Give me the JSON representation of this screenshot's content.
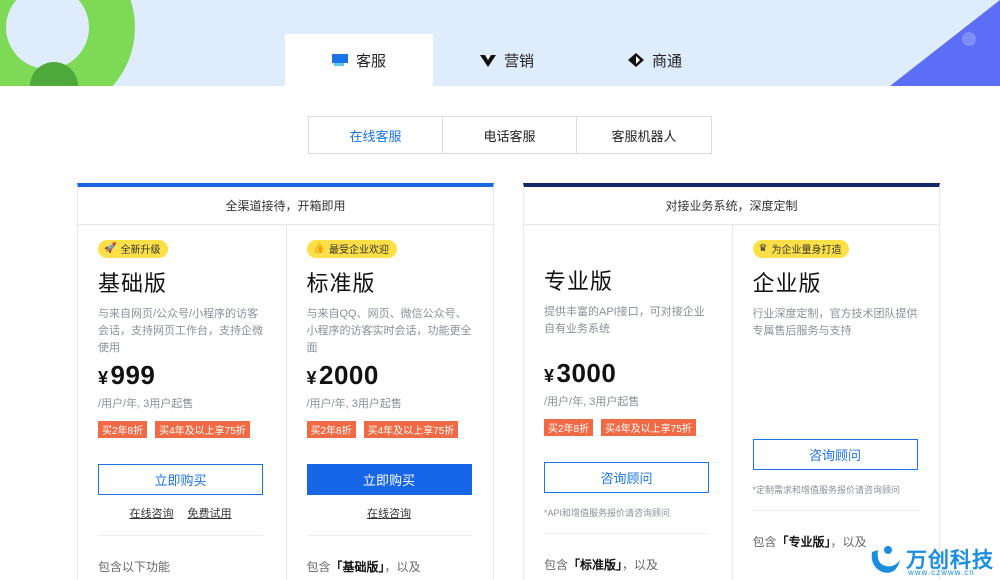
{
  "main_tabs": [
    {
      "label": "客服",
      "icon": "chat-window-icon",
      "active": true
    },
    {
      "label": "营销",
      "icon": "marketing-arrow-icon",
      "active": false
    },
    {
      "label": "商通",
      "icon": "diamond-icon",
      "active": false
    }
  ],
  "sub_tabs": [
    {
      "label": "在线客服",
      "active": true
    },
    {
      "label": "电话客服",
      "active": false
    },
    {
      "label": "客服机器人",
      "active": false
    }
  ],
  "groups": [
    {
      "title": "全渠道接待，开箱即用",
      "accent": "#1967e3",
      "plans": [
        {
          "badge": "全新升级",
          "name": "基础版",
          "desc": "与来自网页/公众号/小程序的访客会话，支持网页工作台，支持企微使用",
          "currency": "¥",
          "price": "999",
          "unit": "/用户/年, 3用户起售",
          "tags": [
            "买2年8折",
            "买4年及以上享75折"
          ],
          "button": "立即购买",
          "links": [
            "在线咨询",
            "免费试用"
          ],
          "features_prefix": "包含以下功能",
          "features_bold": "",
          "features_suffix": ""
        },
        {
          "badge": "最受企业欢迎",
          "name": "标准版",
          "desc": "与来自QQ、网页、微信公众号、小程序的访客实时会话，功能更全面",
          "currency": "¥",
          "price": "2000",
          "unit": "/用户/年, 3用户起售",
          "tags": [
            "买2年8折",
            "买4年及以上享75折"
          ],
          "button": "立即购买",
          "links": [
            "在线咨询"
          ],
          "features_prefix": "包含",
          "features_bold": "「基础版」",
          "features_suffix": "，以及"
        }
      ]
    },
    {
      "title": "对接业务系统，深度定制",
      "accent": "#14286b",
      "plans": [
        {
          "badge": "",
          "name": "专业版",
          "desc": "提供丰富的API接口，可对接企业自有业务系统",
          "currency": "¥",
          "price": "3000",
          "unit": "/用户/年, 3用户起售",
          "tags": [
            "买2年8折",
            "买4年及以上享75折"
          ],
          "button": "咨询顾问",
          "note": "*API和增值服务报价请咨询顾问",
          "features_prefix": "包含",
          "features_bold": "「标准版」",
          "features_suffix": "，以及"
        },
        {
          "badge": "为企业量身打造",
          "name": "企业版",
          "desc": "行业深度定制，官方技术团队提供专属售后服务与支持",
          "button": "咨询顾问",
          "note": "*定制需求和增值服务报价请咨询顾问",
          "features_prefix": "包含",
          "features_bold": "「专业版」",
          "features_suffix": "，以及"
        }
      ]
    }
  ],
  "watermark": {
    "text": "万创科技",
    "sub": "www.czwww.cn"
  }
}
